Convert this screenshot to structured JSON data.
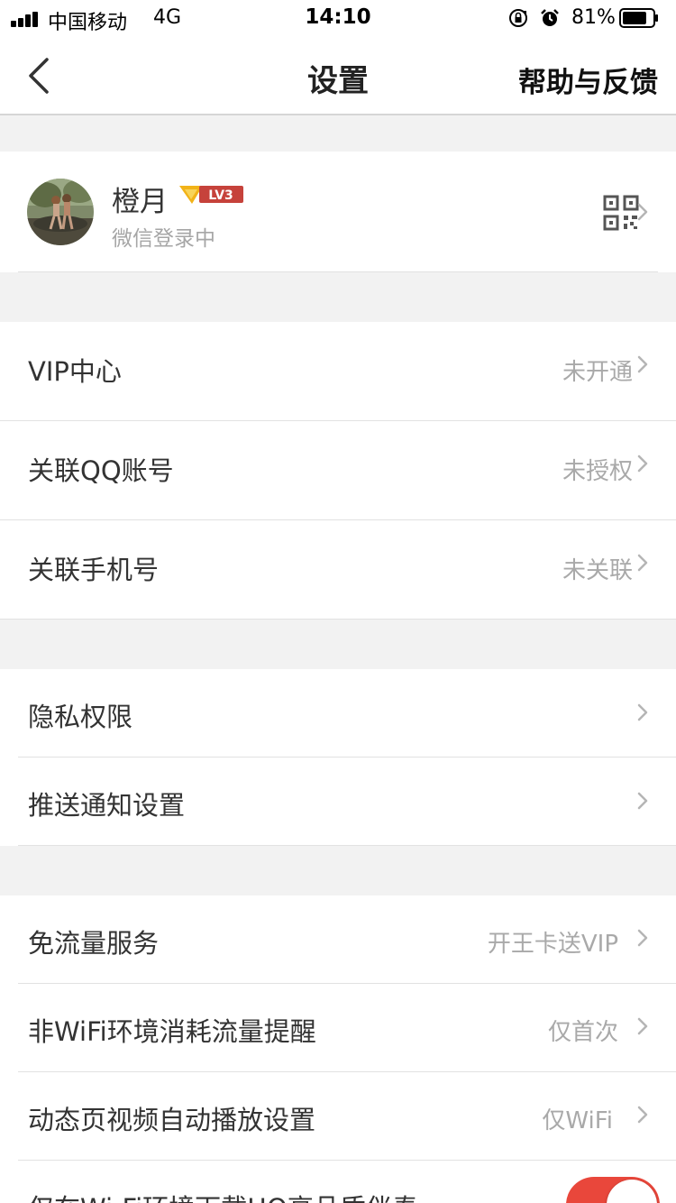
{
  "status_bar": {
    "carrier": "中国移动",
    "network": "4G",
    "time": "14:10",
    "battery_percent": "81%",
    "battery_level": 0.81
  },
  "nav": {
    "title": "设置",
    "help_label": "帮助与反馈",
    "back_icon": "chevron-left-icon"
  },
  "profile": {
    "name": "橙月",
    "level": "LV3",
    "login_status": "微信登录中",
    "qr_icon": "qr-code-icon"
  },
  "groups": [
    {
      "rows": [
        {
          "label": "VIP中心",
          "value": "未开通"
        },
        {
          "label": "关联QQ账号",
          "value": "未授权"
        },
        {
          "label": "关联手机号",
          "value": "未关联"
        }
      ]
    },
    {
      "rows": [
        {
          "label": "隐私权限",
          "value": ""
        },
        {
          "label": "推送通知设置",
          "value": ""
        }
      ]
    },
    {
      "rows": [
        {
          "label": "免流量服务",
          "value": "开王卡送VIP"
        },
        {
          "label": "非WiFi环境消耗流量提醒",
          "value": "仅首次"
        },
        {
          "label": "动态页视频自动播放设置",
          "value": "仅WiFi"
        },
        {
          "label": "仅在Wi-Fi环境下载HQ高品质伴奏",
          "value": "",
          "toggle": true
        }
      ]
    }
  ],
  "colors": {
    "accent": "#e9473b",
    "badge_gold": "#f2b318",
    "badge_red": "#c6423b",
    "background": "#f2f2f2"
  }
}
